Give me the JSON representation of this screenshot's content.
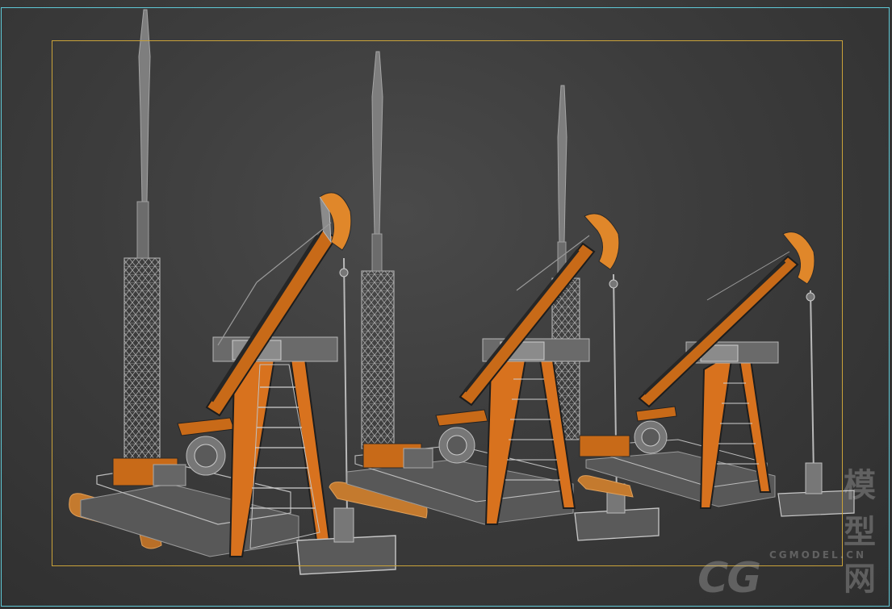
{
  "viewport": {
    "border_color": "#5fc8d6",
    "safe_frame_color": "#c9a23a",
    "background": "#3c3c3c"
  },
  "scene": {
    "subject": "pumpjack",
    "count": 3,
    "colors": {
      "frame": "#d8721e",
      "frame_dark": "#1c1c1c",
      "wire": "#a8a8a8",
      "metal": "#8a8a8a"
    }
  },
  "watermark": {
    "small": "CGMODEL.CN",
    "large": "CG",
    "cn": "模型网"
  }
}
